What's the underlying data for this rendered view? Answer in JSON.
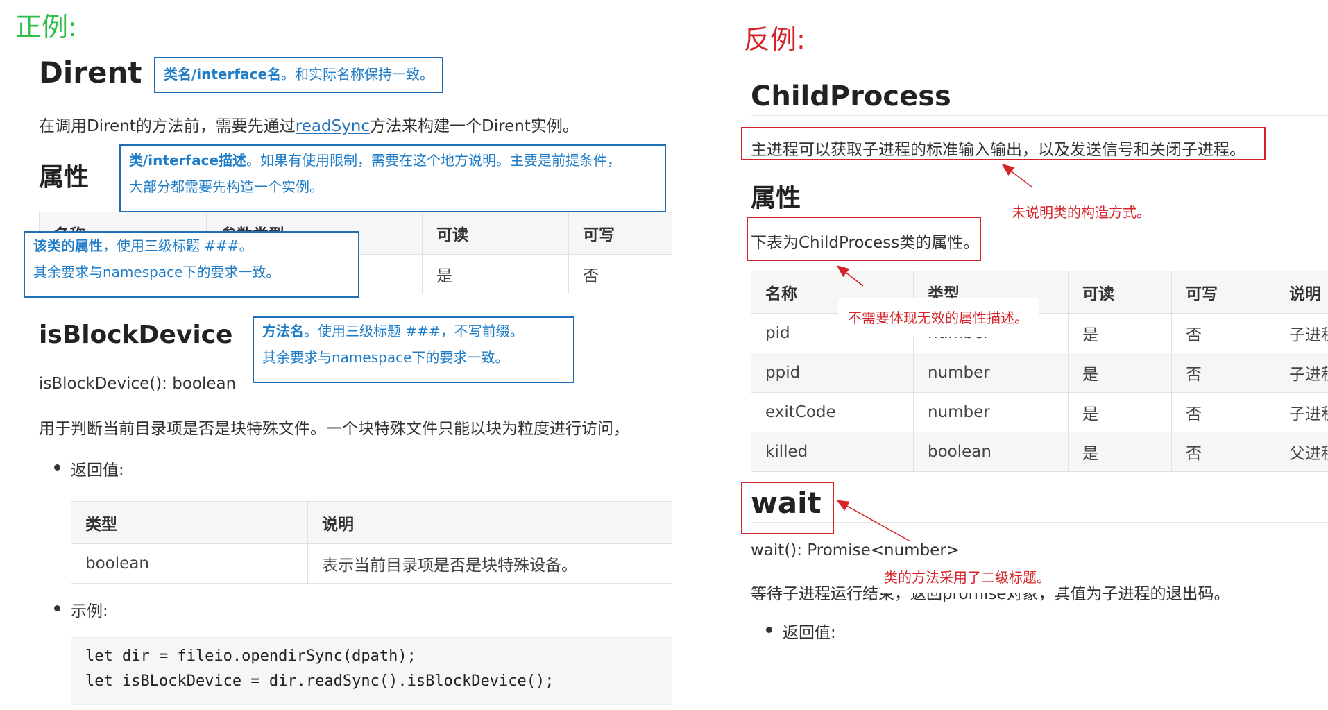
{
  "left": {
    "label": "正例:",
    "title": "Dirent",
    "intro_prefix": "在调用Dirent的方法前，需要先通过",
    "intro_link": "readSync",
    "intro_suffix": "方法来构建一个Dirent实例。",
    "attr_heading": "属性",
    "attr_table": {
      "headers": [
        "名称",
        "参数类型",
        "可读",
        "可写"
      ],
      "rows": [
        [
          "",
          "",
          "是",
          "否"
        ]
      ]
    },
    "method_heading": "isBlockDevice",
    "signature": "isBlockDevice(): boolean",
    "description": "用于判断当前目录项是否是块特殊文件。一个块特殊文件只能以块为粒度进行访问，",
    "return_label": "返回值:",
    "return_table": {
      "headers": [
        "类型",
        "说明"
      ],
      "rows": [
        [
          "boolean",
          "表示当前目录项是否是块特殊设备。"
        ]
      ]
    },
    "example_label": "示例:",
    "code": [
      "let dir = fileio.opendirSync(dpath);",
      "let isBLockDevice = dir.readSync().isBlockDevice();"
    ]
  },
  "notes": {
    "n1_bold": "类名/interface名",
    "n1_rest": "。和实际名称保持一致。",
    "n2_bold": "类/interface描述",
    "n2_rest": "。如果有使用限制，需要在这个地方说明。主要是前提条件，",
    "n2_line2": "大部分都需要先构造一个实例。",
    "n3_bold": "该类的属性",
    "n3_rest": "，使用三级标题 ###。",
    "n3_line2": "其余要求与namespace下的要求一致。",
    "n4_bold": "方法名",
    "n4_rest": "。使用三级标题 ###，不写前缀。",
    "n4_line2": "其余要求与namespace下的要求一致。"
  },
  "right": {
    "label": "反例:",
    "title": "ChildProcess",
    "intro": "主进程可以获取子进程的标准输入输出，以及发送信号和关闭子进程。",
    "attr_heading": "属性",
    "table_intro": "下表为ChildProcess类的属性。",
    "table": {
      "headers": [
        "名称",
        "类型",
        "可读",
        "可写",
        "说明"
      ],
      "rows": [
        [
          "pid",
          "number",
          "是",
          "否",
          "子进程"
        ],
        [
          "ppid",
          "number",
          "是",
          "否",
          "子进程"
        ],
        [
          "exitCode",
          "number",
          "是",
          "否",
          "子进程"
        ],
        [
          "killed",
          "boolean",
          "是",
          "否",
          "父进程"
        ]
      ]
    },
    "method_heading": "wait",
    "signature": "wait(): Promise<number>",
    "description": "等待子进程运行结束，返回promise对象，其值为子进程的退出码。",
    "return_label": "返回值:",
    "annotations": {
      "a1": "未说明类的构造方式。",
      "a2": "不需要体现无效的属性描述。",
      "a3": "类的方法采用了二级标题。"
    }
  },
  "colors": {
    "good_label": "#2fbf4a",
    "bad_label": "#d6232a",
    "note_blue": "#1f6fb8",
    "red": "#d6232a",
    "link": "#2b72b8"
  }
}
